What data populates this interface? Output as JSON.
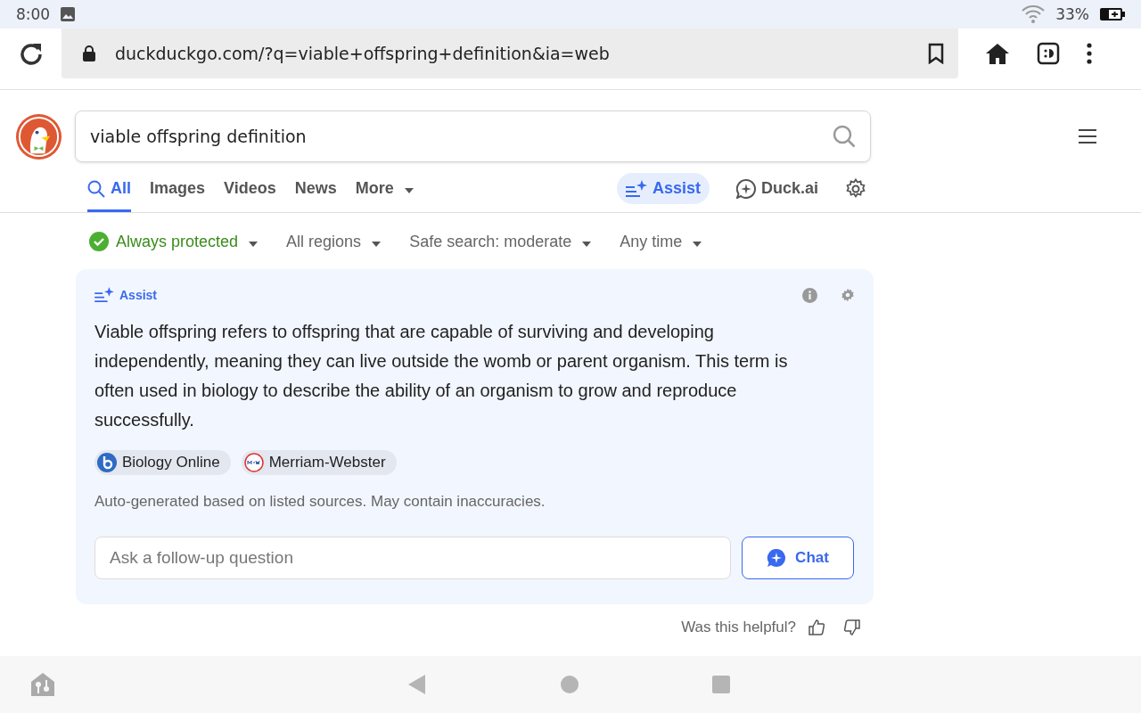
{
  "status_bar": {
    "time": "8:00",
    "battery": "33%"
  },
  "address_bar": {
    "url": "duckduckgo.com/?q=viable+offspring+definition&ia=web"
  },
  "search": {
    "value": "viable offspring definition"
  },
  "tabs": [
    {
      "label": "All",
      "selected": true,
      "kind": "search"
    },
    {
      "label": "Images",
      "selected": false,
      "kind": "plain"
    },
    {
      "label": "Videos",
      "selected": false,
      "kind": "plain"
    },
    {
      "label": "News",
      "selected": false,
      "kind": "plain"
    },
    {
      "label": "More",
      "selected": false,
      "kind": "dropdown"
    }
  ],
  "nav_links": [
    {
      "label": "Assist",
      "kind": "assist"
    },
    {
      "label": "Duck.ai",
      "kind": "chat"
    }
  ],
  "filters": [
    {
      "label": "Always protected",
      "kind": "protected"
    },
    {
      "label": "All regions",
      "kind": "plain"
    },
    {
      "label": "Safe search: moderate",
      "kind": "plain"
    },
    {
      "label": "Any time",
      "kind": "plain"
    }
  ],
  "assist": {
    "title": "Assist",
    "answer": "Viable offspring refers to offspring that are capable of surviving and developing independently, meaning they can live outside the womb or parent organism. This term is often used in biology to describe the ability of an organism to grow and reproduce successfully.",
    "sources": [
      {
        "name": "Biology Online",
        "kind": "bio"
      },
      {
        "name": "Merriam-Webster",
        "kind": "mw"
      }
    ],
    "disclaimer": "Auto-generated based on listed sources. May contain inaccuracies.",
    "followup": {
      "placeholder": "Ask a follow-up question"
    },
    "chat_button": "Chat"
  },
  "feedback": {
    "question": "Was this helpful?"
  }
}
